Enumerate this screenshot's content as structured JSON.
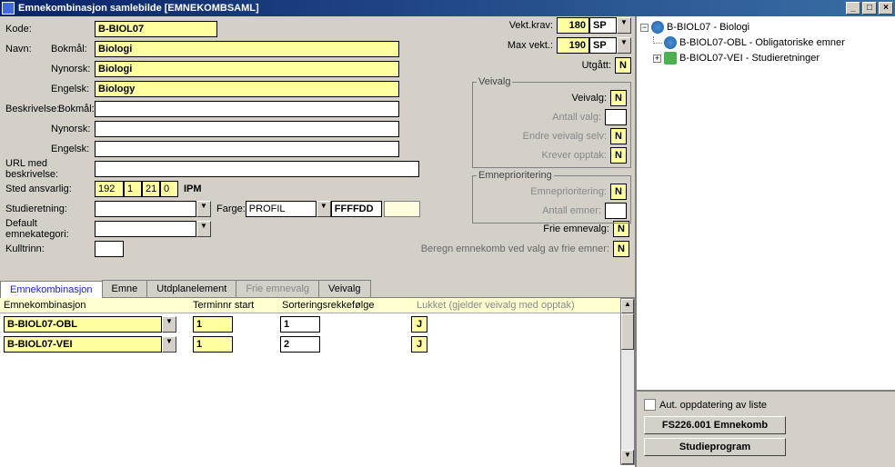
{
  "window": {
    "title": "Emnekombinasjon samlebilde   [EMNEKOMBSAML]"
  },
  "form": {
    "kode_label": "Kode:",
    "kode_value": "B-BIOL07",
    "navn_label": "Navn:",
    "bokmal_label": "Bokmål:",
    "bokmal_value": "Biologi",
    "nynorsk_label": "Nynorsk:",
    "nynorsk_value": "Biologi",
    "engelsk_label": "Engelsk:",
    "engelsk_value": "Biology",
    "beskrivelse_label": "Beskrivelse:",
    "beskr_bokmal": "",
    "beskr_nynorsk": "",
    "beskr_engelsk": "",
    "url_label": "URL med beskrivelse:",
    "url_value": "",
    "sted_label": "Sted ansvarlig:",
    "sted_1": "192",
    "sted_2": "1",
    "sted_3": "21",
    "sted_4": "0",
    "sted_name": "IPM",
    "studieretning_label": "Studieretning:",
    "studieretning_value": "",
    "farge_label": "Farge:",
    "farge_combo": "PROFIL",
    "farge_value": "FFFFDD",
    "default_emnekat_label": "Default emnekategori:",
    "default_emnekat_value": "",
    "kulltrinn_label": "Kulltrinn:",
    "kulltrinn_value": "",
    "beregn_label": "Beregn emnekomb ved valg av frie emner:",
    "beregn_value": "N"
  },
  "vekt": {
    "krav_label": "Vekt.krav:",
    "krav_value": "180",
    "krav_unit": "SP",
    "max_label": "Max vekt.:",
    "max_value": "190",
    "max_unit": "SP",
    "utgatt_label": "Utgått:",
    "utgatt_value": "N"
  },
  "veivalg": {
    "legend": "Veivalg",
    "veivalg_label": "Veivalg:",
    "veivalg_value": "N",
    "antall_label": "Antall valg:",
    "antall_value": "",
    "endre_label": "Endre veivalg selv:",
    "endre_value": "N",
    "krever_label": "Krever opptak:",
    "krever_value": "N"
  },
  "emneprio": {
    "legend": "Emneprioritering",
    "prio_label": "Emneprioritering:",
    "prio_value": "N",
    "antall_label": "Antall emner:",
    "antall_value": ""
  },
  "frie": {
    "label": "Frie emnevalg:",
    "value": "N"
  },
  "tabs": {
    "t1": "Emnekombinasjon",
    "t2": "Emne",
    "t3": "Utdplanelement",
    "t4": "Frie emnevalg",
    "t5": "Veivalg"
  },
  "grid": {
    "header_emnekomb": "Emnekombinasjon",
    "header_termin": "Terminnr start",
    "header_sort": "Sorteringsrekkefølge",
    "header_lukket": "Lukket (gjelder veivalg med opptak)",
    "rows": [
      {
        "name": "B-BIOL07-OBL",
        "termin": "1",
        "sort": "1",
        "lukket": "J"
      },
      {
        "name": "B-BIOL07-VEI",
        "termin": "1",
        "sort": "2",
        "lukket": "J"
      }
    ]
  },
  "tree": {
    "root": "B-BIOL07 - Biologi",
    "children": [
      "B-BIOL07-OBL - Obligatoriske emner",
      "B-BIOL07-VEI - Studieretninger"
    ]
  },
  "right_bottom": {
    "auto_update": "Aut. oppdatering av liste",
    "btn_emnekomb": "FS226.001 Emnekomb",
    "btn_studieprogram": "Studieprogram"
  }
}
